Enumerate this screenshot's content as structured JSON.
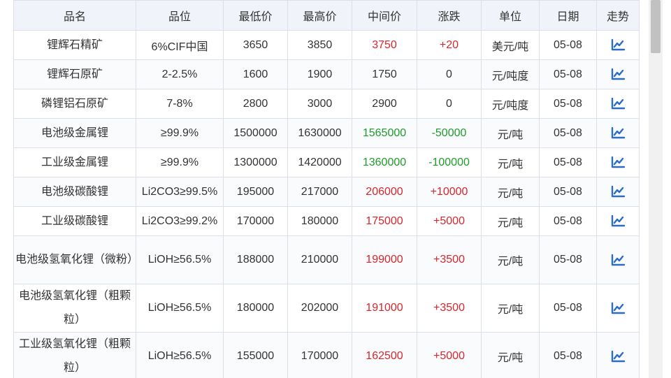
{
  "table": {
    "headers": [
      "品名",
      "品位",
      "最低价",
      "最高价",
      "中间价",
      "涨跌",
      "单位",
      "日期",
      "走势"
    ],
    "rows": [
      {
        "name": "锂辉石精矿",
        "grade": "6%CIF中国",
        "low": "3650",
        "high": "3850",
        "mid": "3750",
        "change": "+20",
        "unit": "美元/吨",
        "date": "05-08",
        "trend": "up"
      },
      {
        "name": "锂辉石原矿",
        "grade": "2-2.5%",
        "low": "1600",
        "high": "1900",
        "mid": "1750",
        "change": "0",
        "unit": "元/吨度",
        "date": "05-08",
        "trend": "neutral"
      },
      {
        "name": "磷锂铝石原矿",
        "grade": "7-8%",
        "low": "2800",
        "high": "3000",
        "mid": "2900",
        "change": "0",
        "unit": "元/吨度",
        "date": "05-08",
        "trend": "neutral"
      },
      {
        "name": "电池级金属锂",
        "grade": "≥99.9%",
        "low": "1500000",
        "high": "1630000",
        "mid": "1565000",
        "change": "-50000",
        "unit": "元/吨",
        "date": "05-08",
        "trend": "down"
      },
      {
        "name": "工业级金属锂",
        "grade": "≥99.9%",
        "low": "1300000",
        "high": "1420000",
        "mid": "1360000",
        "change": "-100000",
        "unit": "元/吨",
        "date": "05-08",
        "trend": "down"
      },
      {
        "name": "电池级碳酸锂",
        "grade": "Li2CO3≥99.5%",
        "low": "195000",
        "high": "217000",
        "mid": "206000",
        "change": "+10000",
        "unit": "元/吨",
        "date": "05-08",
        "trend": "up"
      },
      {
        "name": "工业级碳酸锂",
        "grade": "Li2CO3≥99.2%",
        "low": "170000",
        "high": "180000",
        "mid": "175000",
        "change": "+5000",
        "unit": "元/吨",
        "date": "05-08",
        "trend": "up"
      },
      {
        "name": "电池级氢氧化锂（微粉）",
        "grade": "LiOH≥56.5%",
        "low": "188000",
        "high": "210000",
        "mid": "199000",
        "change": "+3500",
        "unit": "元/吨",
        "date": "05-08",
        "trend": "up"
      },
      {
        "name": "电池级氢氧化锂（粗颗粒）",
        "grade": "LiOH≥56.5%",
        "low": "180000",
        "high": "202000",
        "mid": "191000",
        "change": "+3500",
        "unit": "元/吨",
        "date": "05-08",
        "trend": "up"
      },
      {
        "name": "工业级氢氧化锂（粗颗粒）",
        "grade": "LiOH≥56.5%",
        "low": "155000",
        "high": "170000",
        "mid": "162500",
        "change": "+5000",
        "unit": "元/吨",
        "date": "05-08",
        "trend": "up"
      }
    ]
  },
  "icons": {
    "trend": "trend-chart-icon"
  },
  "colors": {
    "up": "#d9262c",
    "down": "#1f9b2b",
    "neutral": "#333333",
    "header_bg": "#f0f4fa",
    "border": "#dcdfe6",
    "icon": "#2b6cc4"
  }
}
